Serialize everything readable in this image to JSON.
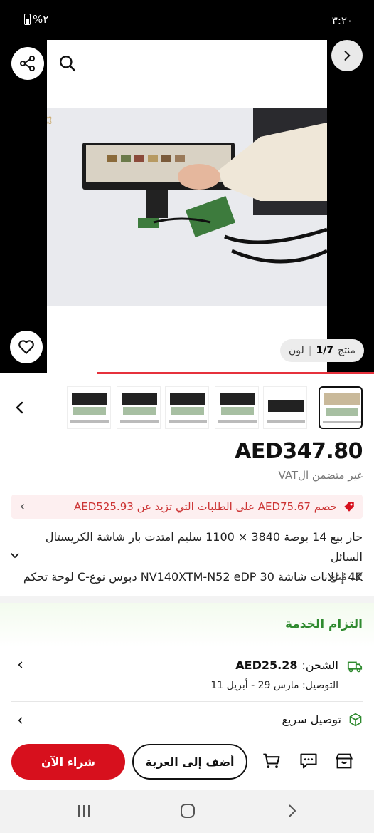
{
  "status_bar": {
    "time": "٣:٢٠",
    "battery": "%٢"
  },
  "gallery": {
    "counter_label": "منتج",
    "counter_value": "1/7",
    "color_label": "لون",
    "thumbnail_count": 6
  },
  "product": {
    "price": "AED347.80",
    "vat_note": "غير متضمن الVAT",
    "promo": {
      "discount_prefix": "خصم",
      "discount_amount": "AED75.67",
      "condition": "على الطلبات التي تزيد عن",
      "threshold": "AED525.93"
    },
    "title_line1": "حار بيع 14 بوصة 3840 × 1100 سليم امتدت بار شاشة الكريستال السائل",
    "title_line2": "4K إعلانات شاشة NV140XTM-N52 eDP 30 دبوس نوع-C لوحة تحكم",
    "sold": "12 مُباع"
  },
  "service": {
    "heading": "التزام الخدمة",
    "shipping_label": "الشحن:",
    "shipping_price": "AED25.28",
    "delivery": "التوصيل: مارس 29 - أبريل 11",
    "fast_delivery": "توصيل سريع"
  },
  "actions": {
    "add_to_cart": "أضف إلى العربة",
    "buy_now": "شراء الآن"
  },
  "colors": {
    "accent": "#d7101d",
    "service_green": "#2f8a2f"
  }
}
